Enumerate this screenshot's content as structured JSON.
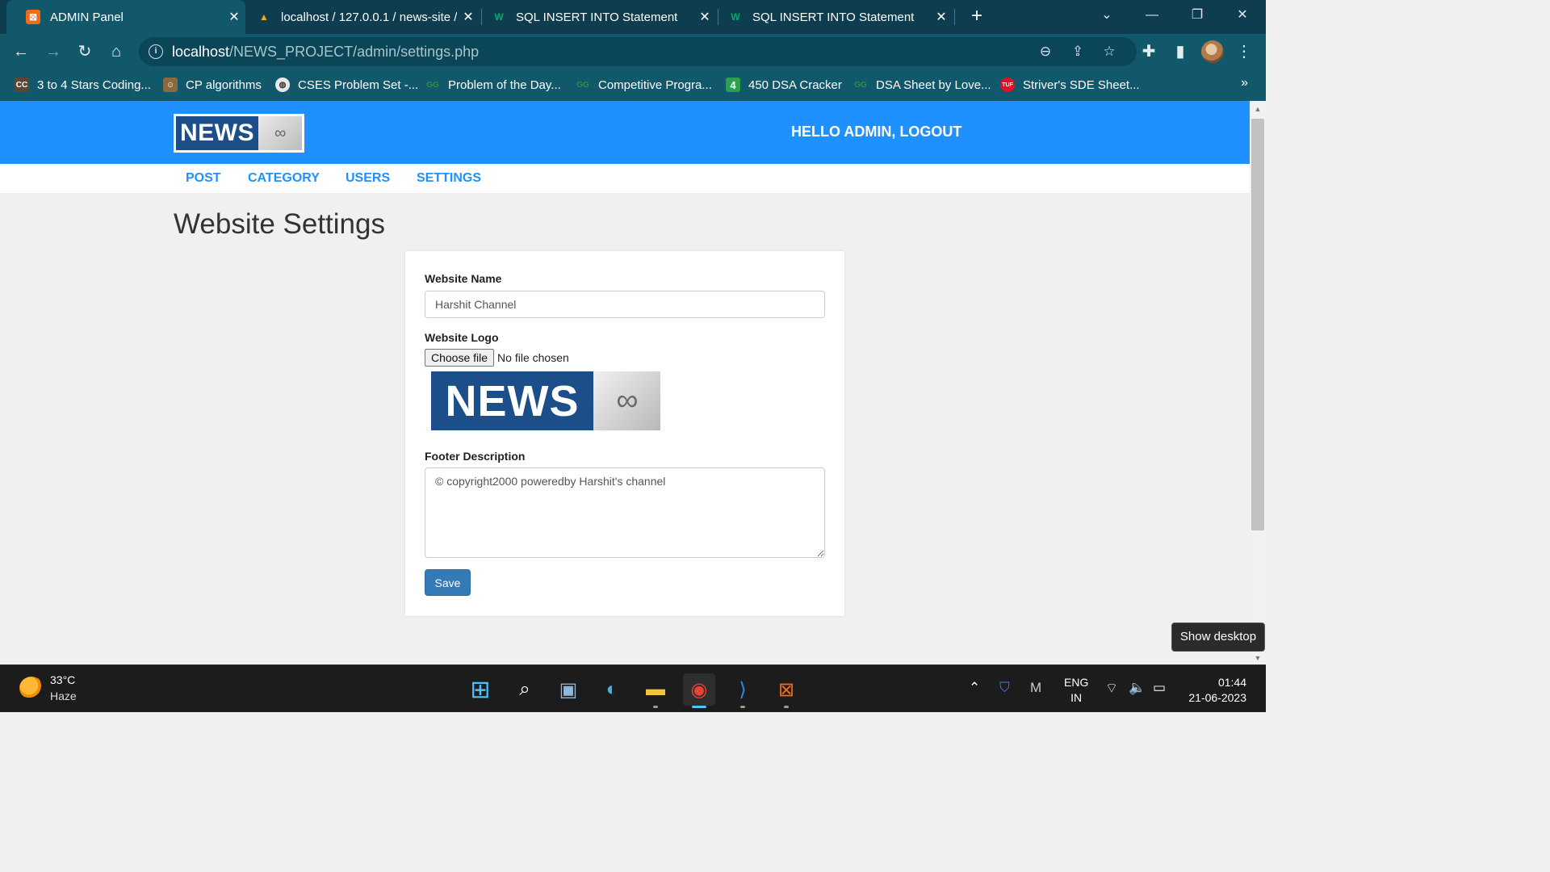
{
  "browser": {
    "tabs": [
      {
        "title": "ADMIN Panel",
        "active": true,
        "icon": "xampp-icon"
      },
      {
        "title": "localhost / 127.0.0.1 / news-site /",
        "active": false,
        "icon": "phpmyadmin-icon"
      },
      {
        "title": "SQL INSERT INTO Statement",
        "active": false,
        "icon": "w3schools-icon"
      },
      {
        "title": "SQL INSERT INTO Statement",
        "active": false,
        "icon": "w3schools-icon"
      }
    ],
    "url_host": "localhost",
    "url_path": "/NEWS_PROJECT/admin/settings.php",
    "bookmarks": [
      {
        "label": "3 to 4 Stars Coding...",
        "icon": "codechef-icon"
      },
      {
        "label": "CP algorithms",
        "icon": "cp-algorithms-icon"
      },
      {
        "label": "CSES Problem Set -...",
        "icon": "globe-icon"
      },
      {
        "label": "Problem of the Day...",
        "icon": "gfg-icon"
      },
      {
        "label": "Competitive Progra...",
        "icon": "gfg-icon"
      },
      {
        "label": "450 DSA Cracker",
        "icon": "450-dsa-icon"
      },
      {
        "label": "DSA Sheet by Love...",
        "icon": "gfg-icon"
      },
      {
        "label": "Striver's SDE Sheet...",
        "icon": "tuf-icon"
      }
    ]
  },
  "site": {
    "logo_text": "NEWS",
    "greeting": "HELLO ADMIN, LOGOUT",
    "menu": [
      "POST",
      "CATEGORY",
      "USERS",
      "SETTINGS"
    ],
    "page_title": "Website Settings"
  },
  "form": {
    "name_label": "Website Name",
    "name_value": "Harshit Channel",
    "logo_label": "Website Logo",
    "file_button": "Choose file",
    "file_status": "No file chosen",
    "footer_label": "Footer Description",
    "footer_value": "© copyright2000 poweredby Harshit's channel",
    "save_label": "Save"
  },
  "tooltip": "Show desktop",
  "taskbar": {
    "temperature": "33°C",
    "condition": "Haze",
    "lang_line1": "ENG",
    "lang_line2": "IN",
    "time": "01:44",
    "date": "21-06-2023"
  },
  "colors": {
    "header_blue": "#1e90ff",
    "save_blue": "#337ab7",
    "chrome_teal": "#12586b"
  }
}
